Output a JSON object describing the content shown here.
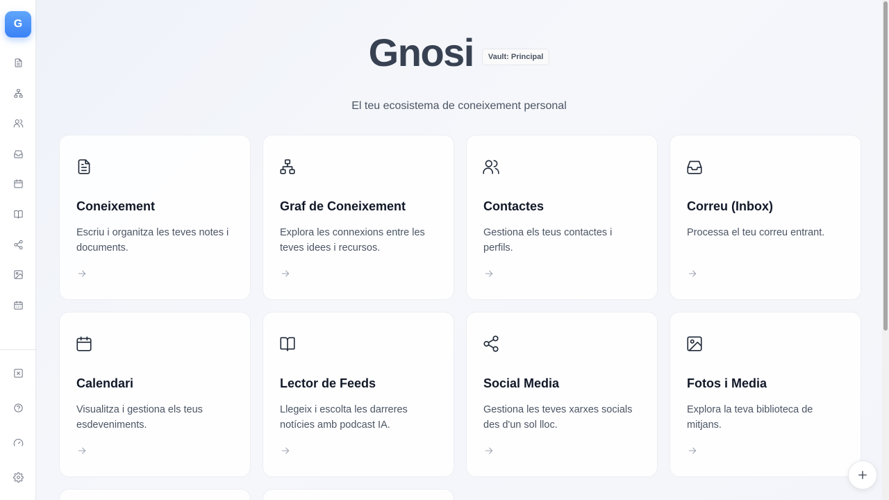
{
  "app": {
    "logo_letter": "G",
    "title": "Gnosi",
    "vault_badge": "Vault: Principal",
    "subtitle": "El teu ecosistema de coneixement personal"
  },
  "sidebar": {
    "top_icons": [
      "document-icon",
      "graph-icon",
      "contacts-icon",
      "inbox-icon",
      "calendar-icon",
      "book-icon",
      "share-icon",
      "image-icon",
      "calendar-grid-icon"
    ],
    "bottom_icons": [
      "close-box-icon",
      "help-icon",
      "gauge-icon",
      "settings-icon"
    ]
  },
  "cards": [
    {
      "icon": "document-icon",
      "title": "Coneixement",
      "description": "Escriu i organitza les teves notes i documents."
    },
    {
      "icon": "graph-icon",
      "title": "Graf de Coneixement",
      "description": "Explora les connexions entre les teves idees i recursos."
    },
    {
      "icon": "contacts-icon",
      "title": "Contactes",
      "description": "Gestiona els teus contactes i perfils."
    },
    {
      "icon": "inbox-icon",
      "title": "Correu (Inbox)",
      "description": "Processa el teu correu entrant."
    },
    {
      "icon": "calendar-icon",
      "title": "Calendari",
      "description": "Visualitza i gestiona els teus esdeveniments."
    },
    {
      "icon": "book-icon",
      "title": "Lector de Feeds",
      "description": "Llegeix i escolta les darreres notícies amb podcast IA."
    },
    {
      "icon": "share-icon",
      "title": "Social Media",
      "description": "Gestiona les teves xarxes socials des d'un sol lloc."
    },
    {
      "icon": "image-icon",
      "title": "Fotos i Media",
      "description": "Explora la teva biblioteca de mitjans."
    }
  ],
  "colors": {
    "accent": "#3b82f6",
    "title": "#374151",
    "text_muted": "#4b5563"
  }
}
